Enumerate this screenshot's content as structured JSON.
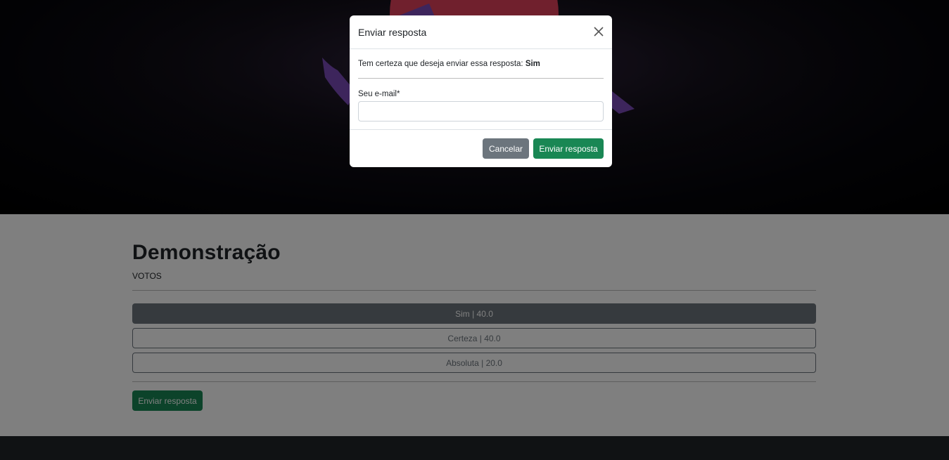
{
  "modal": {
    "title": "Enviar resposta",
    "confirm_prefix": "Tem certeza que deseja enviar essa resposta:",
    "confirm_answer": "Sim",
    "email_label": "Seu e-mail*",
    "email_value": "",
    "email_placeholder": "",
    "cancel_label": "Cancelar",
    "submit_label": "Enviar resposta"
  },
  "poll": {
    "title": "Demonstração",
    "subtitle": "VOTOS",
    "options": [
      {
        "label": "Sim | 40.0",
        "selected": true
      },
      {
        "label": "Certeza | 40.0",
        "selected": false
      },
      {
        "label": "Absoluta | 20.0",
        "selected": false
      }
    ],
    "submit_label": "Enviar resposta"
  },
  "colors": {
    "success": "#198754",
    "secondary": "#6c757d",
    "footer": "#212529"
  }
}
